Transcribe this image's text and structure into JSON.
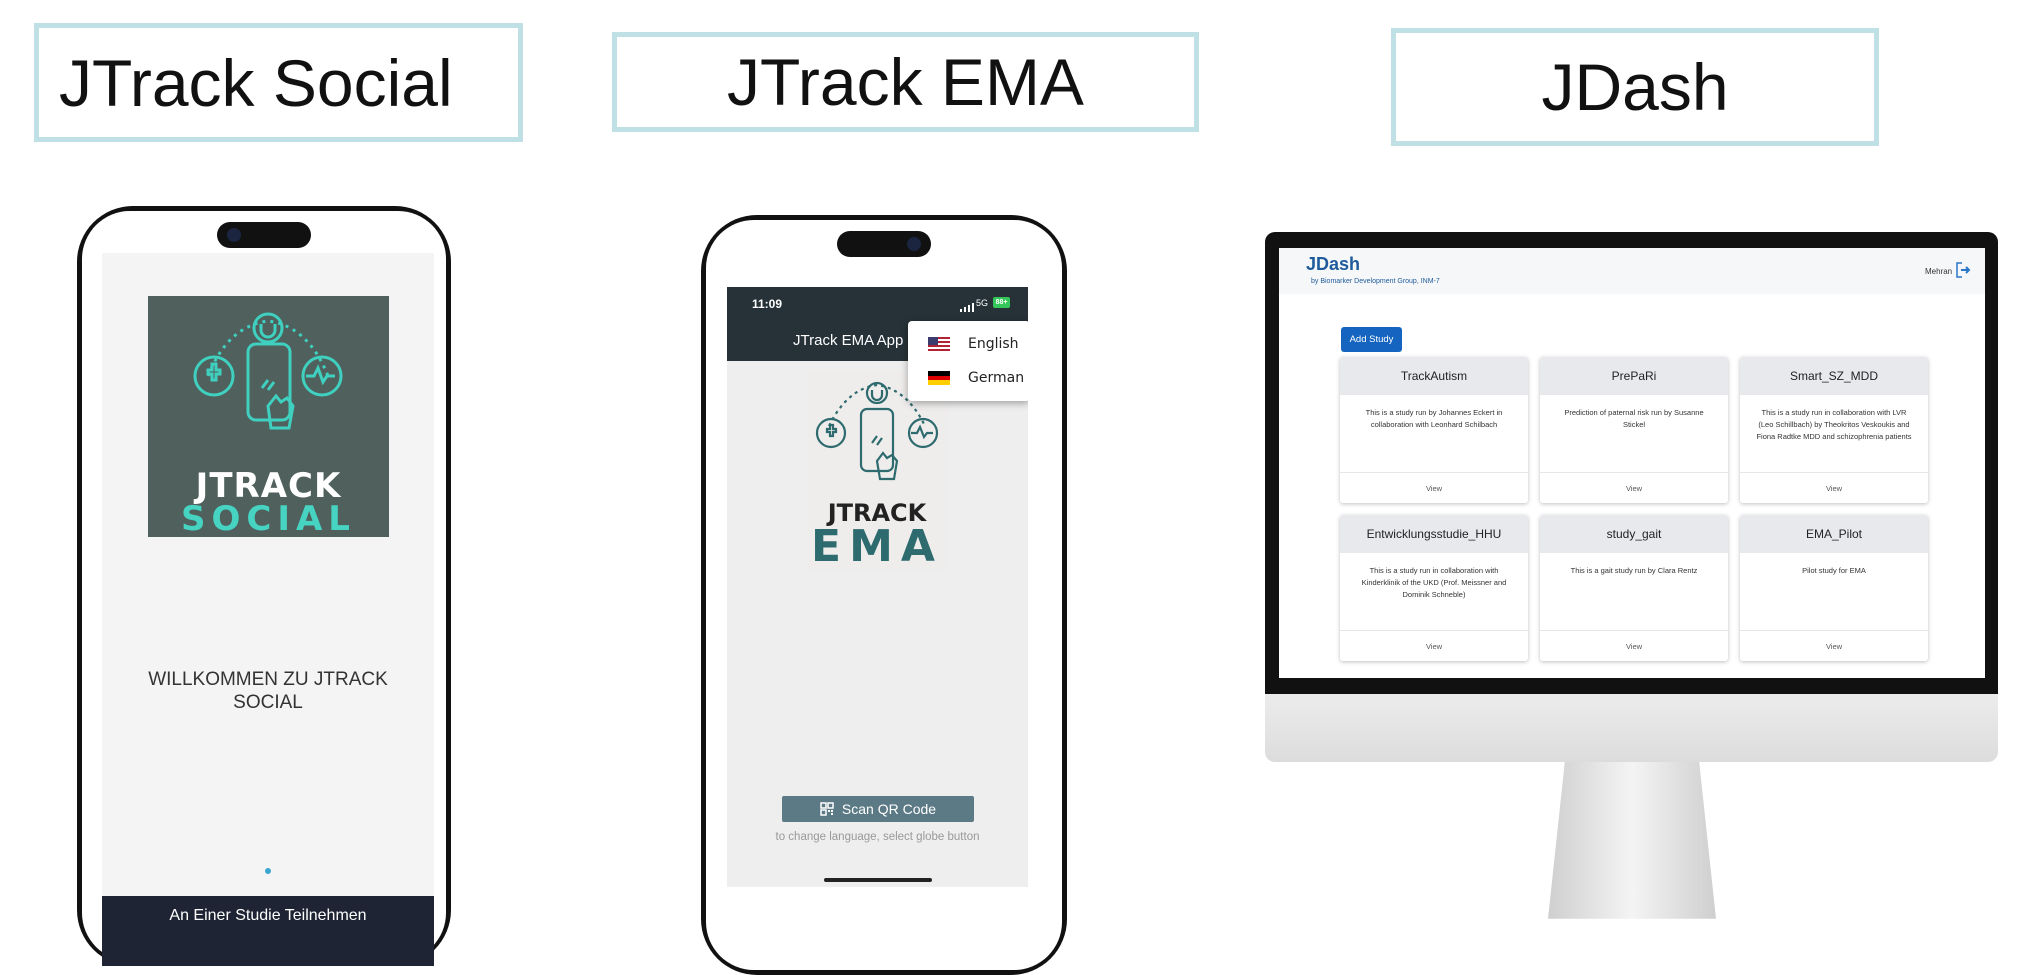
{
  "headings": {
    "social": "JTrack Social",
    "ema": "JTrack EMA",
    "dash": "JDash"
  },
  "social_app": {
    "logo_line1": "JTRACK",
    "logo_line2": "SOCIAL",
    "welcome": "WILLKOMMEN ZU JTRACK SOCIAL",
    "page_indicator_active": 1,
    "join_button": "An Einer Studie Teilnehmen"
  },
  "ema_app": {
    "time": "11:09",
    "signal": "5G",
    "battery": "88+",
    "title": "JTrack EMA App",
    "languages": [
      "English",
      "German"
    ],
    "logo_line1": "JTRACK",
    "logo_line2": "EMA",
    "scan_button": "Scan QR Code",
    "hint": "to change language, select globe button"
  },
  "dashboard": {
    "brand": "JDash",
    "subtitle": "by Biomarker Development Group, INM-7",
    "user": "Mehran",
    "add_button": "Add Study",
    "view_label": "View",
    "studies": [
      {
        "name": "TrackAutism",
        "desc": "This is a study run by Johannes Eckert in collaboration with Leonhard Schilbach"
      },
      {
        "name": "PrePaRi",
        "desc": "Prediction of paternal risk run by Susanne Stickel"
      },
      {
        "name": "Smart_SZ_MDD",
        "desc": "This is a study run in collaboration with LVR (Leo Schillbach) by Theokritos Veskoukis and Fiona Radtke MDD and schizophrenia patients"
      },
      {
        "name": "Entwicklungsstudie_HHU",
        "desc": "This is a study run in collaboration with Kinderklinik of the UKD (Prof. Meissner and Dominik Schneble)"
      },
      {
        "name": "study_gait",
        "desc": "This is a gait study run by Clara Rentz"
      },
      {
        "name": "EMA_Pilot",
        "desc": "Pilot study for EMA"
      }
    ]
  },
  "colors": {
    "heading_border": "#bfe0e4",
    "teal": "#2e6b6e",
    "logo_bg": "#4f605d",
    "social_bar": "#1e2433",
    "ema_status": "#263238",
    "scan_button": "#5b7a86",
    "dash_brand": "#1f5b9c",
    "add_button": "#1565c0"
  },
  "icons": [
    "qr-code-icon",
    "logout-icon",
    "us-flag-icon",
    "german-flag-icon",
    "app-logo-icon"
  ]
}
